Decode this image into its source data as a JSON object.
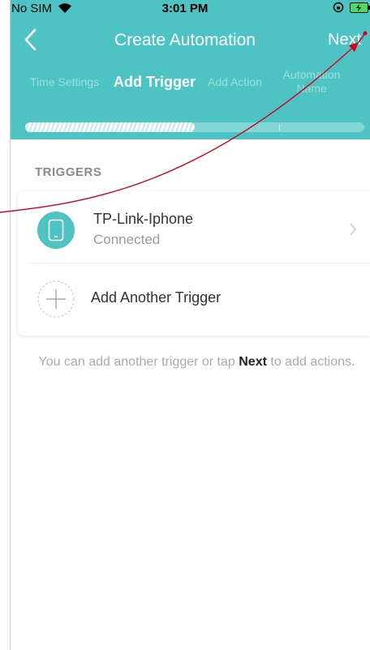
{
  "status_bar": {
    "carrier": "No SIM",
    "time": "3:01 PM",
    "icons": [
      "wifi-icon",
      "lock-rotation-icon",
      "battery-charging-icon"
    ]
  },
  "header": {
    "title": "Create Automation",
    "next_label": "Next",
    "back_icon": "chevron-left-icon",
    "background_color": "#4ec3c4"
  },
  "steps": [
    {
      "label": "Time Settings",
      "state": "done"
    },
    {
      "label": "Add Trigger",
      "state": "active"
    },
    {
      "label": "Add Action",
      "state": "pending"
    },
    {
      "label": "Automation Name",
      "state": "pending"
    }
  ],
  "progress": {
    "fraction": 0.5,
    "segments": 4
  },
  "triggers": {
    "section_label": "TRIGGERS",
    "items": [
      {
        "name": "TP-Link-Iphone",
        "status": "Connected",
        "icon": "phone-icon"
      }
    ],
    "add_label": "Add Another Trigger"
  },
  "hint": {
    "before": "You can add another trigger or tap ",
    "bold": "Next",
    "after": " to add actions."
  },
  "colors": {
    "accent": "#4ec3c4",
    "annotation_arrow": "#d0021b"
  }
}
